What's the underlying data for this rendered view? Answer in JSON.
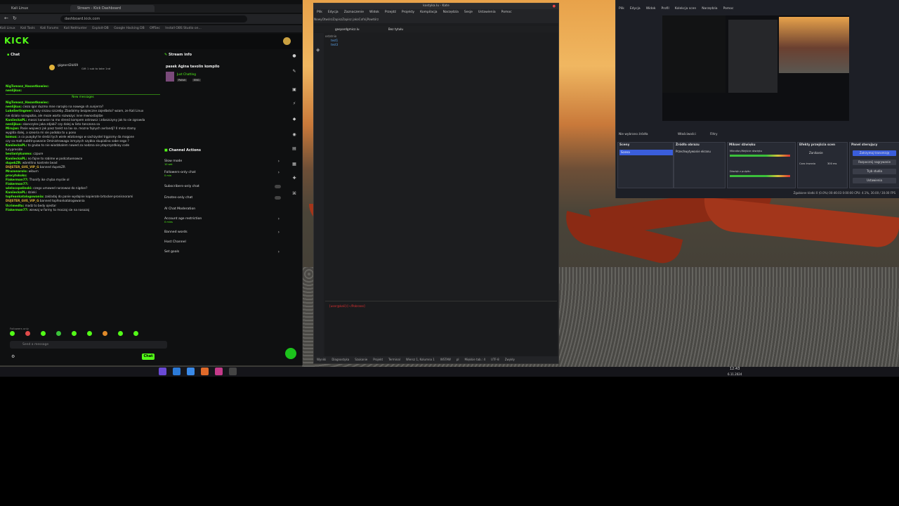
{
  "browser": {
    "tabs": [
      "Kali Linux",
      "Stream - Kick Dashboard"
    ],
    "url": "dashboard.kick.com",
    "bookmarks": [
      "Kali Linux",
      "Kali Tools",
      "Kali Forums",
      "Kali NetHunter",
      "Exploit-DB",
      "Google Hacking DB",
      "OffSec",
      "Install OBS Studio on..."
    ],
    "kick_logo": "KICK",
    "chat_title": "Chat",
    "stream_info_title": "Stream info",
    "stream_info": {
      "title": "pasek Agina tavolin kompilo",
      "category": "Just Chatting",
      "tags": [
        "Polish",
        "ENG"
      ]
    },
    "pinned": "gigzord2ki69",
    "pinned_sub": "Gift 1 sub to take 1nd",
    "new_messages": "New messages",
    "chat_lines": [
      {
        "user": "NigTomasz_Hasantkowiec:",
        "text": ""
      },
      {
        "user": "nenlijkus:",
        "text": ""
      },
      {
        "user": "NigTomasz_Hasantkowiec:",
        "text": ""
      },
      {
        "user": "nenlijkus:",
        "text": "ciezo igor duzmo mne naraplo na nowego sh.sunjerra?"
      },
      {
        "user": "LukeSerlingmer:",
        "text": "kazy siszau szczeby. Zbadalmy bezpieczne zajedbsto? wzam, ze Kali Linux"
      },
      {
        "user": "",
        "text": "nie dzialo naragazba, ale moze warto rozwazyc inne mwnostajdze"
      },
      {
        "user": "KaniieckaPL:",
        "text": "maszc kananie na mo strenó kompem ostrowcz i zdaszczyny jak to sie zgrowda"
      },
      {
        "user": "nenlijkus:",
        "text": "skonczyles jaka zdjabi? czy dalej w listo tanczona sa"
      },
      {
        "user": "Mirujan:",
        "text": "Pasie wojowcz jak pasz tankt na lax sa. mozna fajnych avrlandj? II mnie stamy"
      },
      {
        "user": "",
        "text": "wyglda dalej, a szeoria mi sie podoba to u pono"
      },
      {
        "user": "bzmus:",
        "text": "a co puaybyl te sledzi tych wiele wtatonego w sachzystel trgpismy da mogone"
      },
      {
        "user": "",
        "text": "czy sa malt subtitnyowanie Oministrowaga inmyzych szybka skupialina sabe sego ?"
      },
      {
        "user": "KaniieckaPL:",
        "text": "to gruba to nie wiodzkalem nowed za nodzna sie ptaprzyzdkiay code"
      },
      {
        "user": "",
        "text": "lucypreside"
      },
      {
        "user": "bestanlykunmo:",
        "text": "czpure"
      },
      {
        "user": "KaniieckaPL:",
        "text": "no fajne to robime w podcatuenowce"
      },
      {
        "user": "dupekZR:",
        "text": "wbrelitno kontrele bead"
      },
      {
        "user": "DUJSTER_GVE_VIP_G",
        "text": "banned dupekZR"
      },
      {
        "user": "Mruzonarolo:",
        "text": "wiburn"
      },
      {
        "user": "procytokoks:",
        "text": ""
      },
      {
        "user": "Fiakerman77:",
        "text": "Thanify ike chyba myslie ol"
      },
      {
        "user": "Fiakerman77:",
        "text": ""
      },
      {
        "user": "wielocopalinski:",
        "text": "czego umowed narzowaz do nigdan?"
      },
      {
        "user": "KaniieckaPL:",
        "text": "dzieki"
      },
      {
        "user": "topfeankatalogowania:",
        "text": "zakladaj do panie wydajnie kopierate brtocker-pronisnorami"
      },
      {
        "user": "DUJSTER_GVE_VIP_G",
        "text": "banned topfeankatalogowania"
      },
      {
        "user": "Ucrimedtu:",
        "text": "madz to bedy ojestar"
      },
      {
        "user": "Fiakerman77:",
        "text": "wiewaj w farmy to moczaj sie na nasozaj"
      }
    ],
    "chat_followers_note": "Followers only",
    "send_placeholder": "Send a message",
    "chat_button": "Chat",
    "channel_actions_title": "Channel Actions",
    "actions": [
      {
        "label": "Slow mode",
        "sub": "10 sek"
      },
      {
        "label": "Followers-only chat",
        "sub": "0 min"
      },
      {
        "label": "Subscribers-only chat",
        "sub": ""
      },
      {
        "label": "Emotes-only chat",
        "sub": ""
      },
      {
        "label": "AI Chat Moderation",
        "sub": ""
      },
      {
        "label": "Account age restriction",
        "sub": "0 mins"
      },
      {
        "label": "Banned words",
        "sub": ""
      },
      {
        "label": "Host Channel",
        "sub": ""
      },
      {
        "label": "Set goals",
        "sub": ""
      }
    ]
  },
  "kate": {
    "title": "kostyka.lu - Kate",
    "menu": [
      "Plik",
      "Edycja",
      "Zaznaczenie",
      "Widok",
      "Przejdź",
      "Projekty",
      "Kompilacja",
      "Narzędzia",
      "Sesje",
      "Ustawienia",
      "Pomoc"
    ],
    "toolbar": [
      "Nowy",
      "Otwórz",
      "Zapisz",
      "Zapisz jako",
      "Cofnij",
      "Powtórz"
    ],
    "tabs": [
      "gaspardgmicz.lu",
      "Bez tytułu"
    ],
    "tree_header": "ostatnio",
    "tree": [
      "test1",
      "test3"
    ],
    "terminal_prompt": "[user@kali]-[~/Pobrane]",
    "status": [
      "Wiersz 1, Kolumna 1",
      "WSTAW",
      "pl",
      "Miękkie tab.: 4",
      "UTF-8",
      "Zwykły"
    ],
    "status_left": [
      "Wyniki",
      "Diagnostyka",
      "Szukanie",
      "Projekt",
      "Terminal"
    ]
  },
  "obs": {
    "menu": [
      "Plik",
      "Edycja",
      "Widok",
      "Profil",
      "Kolekcja scen",
      "Narzędzia",
      "Pomoc"
    ],
    "no_source": "Nie wybrano źródła",
    "properties": "Właściwości",
    "filters": "Filtry",
    "scenes_title": "Sceny",
    "scene_item": "Scena",
    "sources_title": "Źródła obrazu",
    "source_item": "Przechwytywanie ekranu",
    "mixer_title": "Mikser dźwięku",
    "mixer_items": [
      "Mikrofon/Wejście dźwięku",
      "Dźwięk z pulpitu"
    ],
    "transitions_title": "Efekty przejścia scen",
    "transition_value": "Zanikanie",
    "duration_label": "Czas trwania",
    "duration_value": "300 ms",
    "controls_title": "Panel sterujący",
    "controls": [
      "Zatrzymaj transmisję",
      "Rozpocznij nagrywanie",
      "Tryb studia",
      "Ustawienia"
    ],
    "status": "Zgubione klatki 0 (0.0%)   00:46:03   0:00:00   CPU: 4.1%, 30.00 / 30.00 FPS"
  },
  "clock": {
    "time": "12:43",
    "date": "6.11.2024"
  }
}
